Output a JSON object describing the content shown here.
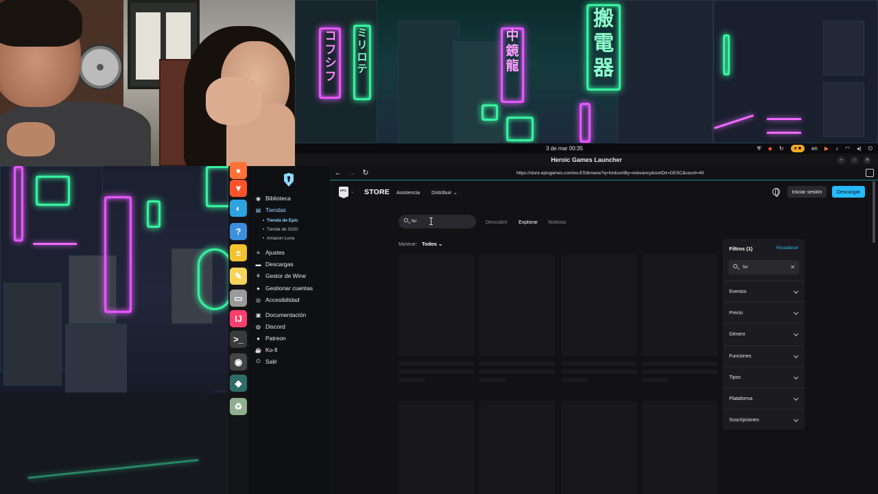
{
  "topbar": {
    "clock": "3 de mar  00:35",
    "lang": "en"
  },
  "window": {
    "title": "Heroic Games Launcher"
  },
  "dock": {
    "items": [
      {
        "name": "firefox-icon",
        "glyph": "●",
        "color": "#ff7139"
      },
      {
        "name": "brave-icon",
        "glyph": "▼",
        "color": "#fb542b"
      },
      {
        "name": "edge-icon",
        "glyph": "◐",
        "color": "#2fa3e0"
      },
      {
        "name": "help-icon",
        "glyph": "?",
        "color": "#3d8fe0"
      },
      {
        "name": "calculator-icon",
        "glyph": "±",
        "color": "#f2c231"
      },
      {
        "name": "text-editor-icon",
        "glyph": "✎",
        "color": "#f7d35a"
      },
      {
        "name": "files-icon",
        "glyph": "▭",
        "color": "#9a9a9a"
      },
      {
        "name": "intellij-icon",
        "glyph": "IJ",
        "color": "#ff3f6e"
      },
      {
        "name": "terminal-icon",
        "glyph": ">_",
        "color": "#3a3a3a"
      },
      {
        "name": "obs-icon",
        "glyph": "◉",
        "color": "#444"
      },
      {
        "name": "heroic-icon",
        "glyph": "◆",
        "color": "#2e6c6a"
      },
      {
        "name": "trash-icon",
        "glyph": "♻",
        "color": "#8fb08f"
      }
    ]
  },
  "sidebar": {
    "items": [
      {
        "label": "Biblioteca",
        "icon": "gamepad-icon",
        "glyph": "◉"
      },
      {
        "label": "Tiendas",
        "icon": "store-icon",
        "glyph": "▤",
        "active": true
      },
      {
        "label": "Ajustes",
        "icon": "sliders-icon",
        "glyph": "≡"
      },
      {
        "label": "Descargas",
        "icon": "downloads-icon",
        "glyph": "▬"
      },
      {
        "label": "Gestor de Wine",
        "icon": "wine-icon",
        "glyph": "⚘"
      },
      {
        "label": "Gestionar cuentas",
        "icon": "user-icon",
        "glyph": "●"
      },
      {
        "label": "Accesibilidad",
        "icon": "accessibility-icon",
        "glyph": "◎"
      },
      {
        "label": "Documentación",
        "icon": "book-icon",
        "glyph": "▣"
      },
      {
        "label": "Discord",
        "icon": "discord-icon",
        "glyph": "◍"
      },
      {
        "label": "Patreon",
        "icon": "patreon-icon",
        "glyph": "●"
      },
      {
        "label": "Ko-fi",
        "icon": "kofi-icon",
        "glyph": "☕"
      },
      {
        "label": "Salir",
        "icon": "power-icon",
        "glyph": "⏻"
      }
    ],
    "stores": [
      {
        "label": "Tienda de Epic",
        "active": true
      },
      {
        "label": "Tienda de GOG"
      },
      {
        "label": "Amazon Luna"
      }
    ]
  },
  "browser": {
    "url": "https://store.epicgames.com/es-ES/browse?q=for&sortBy=relevancy&sortDir=DESC&count=40"
  },
  "epic": {
    "logo_text": "EPIC",
    "store": "STORE",
    "nav": [
      "Asistencia",
      "Distribuir"
    ],
    "signin": "Iniciar sesión",
    "download": "Descargar",
    "search_value": "for",
    "tabs": [
      "Descubrir",
      "Explorar",
      "Noticias"
    ],
    "active_tab": "Explorar",
    "show_label": "Mostrar:",
    "show_value": "Todos"
  },
  "filters": {
    "title": "Filtros (1)",
    "reset": "Restablecer",
    "search_value": "for",
    "rows": [
      "Eventos",
      "Precio",
      "Género",
      "Funciones",
      "Tipos",
      "Plataforma",
      "Suscripciones"
    ]
  },
  "signs": {
    "sign1": "コフシフ",
    "sign2": "ミリロテ",
    "sign3": "中\n鏡\n龍",
    "sign4": "搬\n電\n器"
  },
  "colors": {
    "accent": "#26bbff",
    "active_sidebar": "#8fd6ff",
    "neon_green": "#37f2a0",
    "neon_pink": "#e657ff"
  }
}
